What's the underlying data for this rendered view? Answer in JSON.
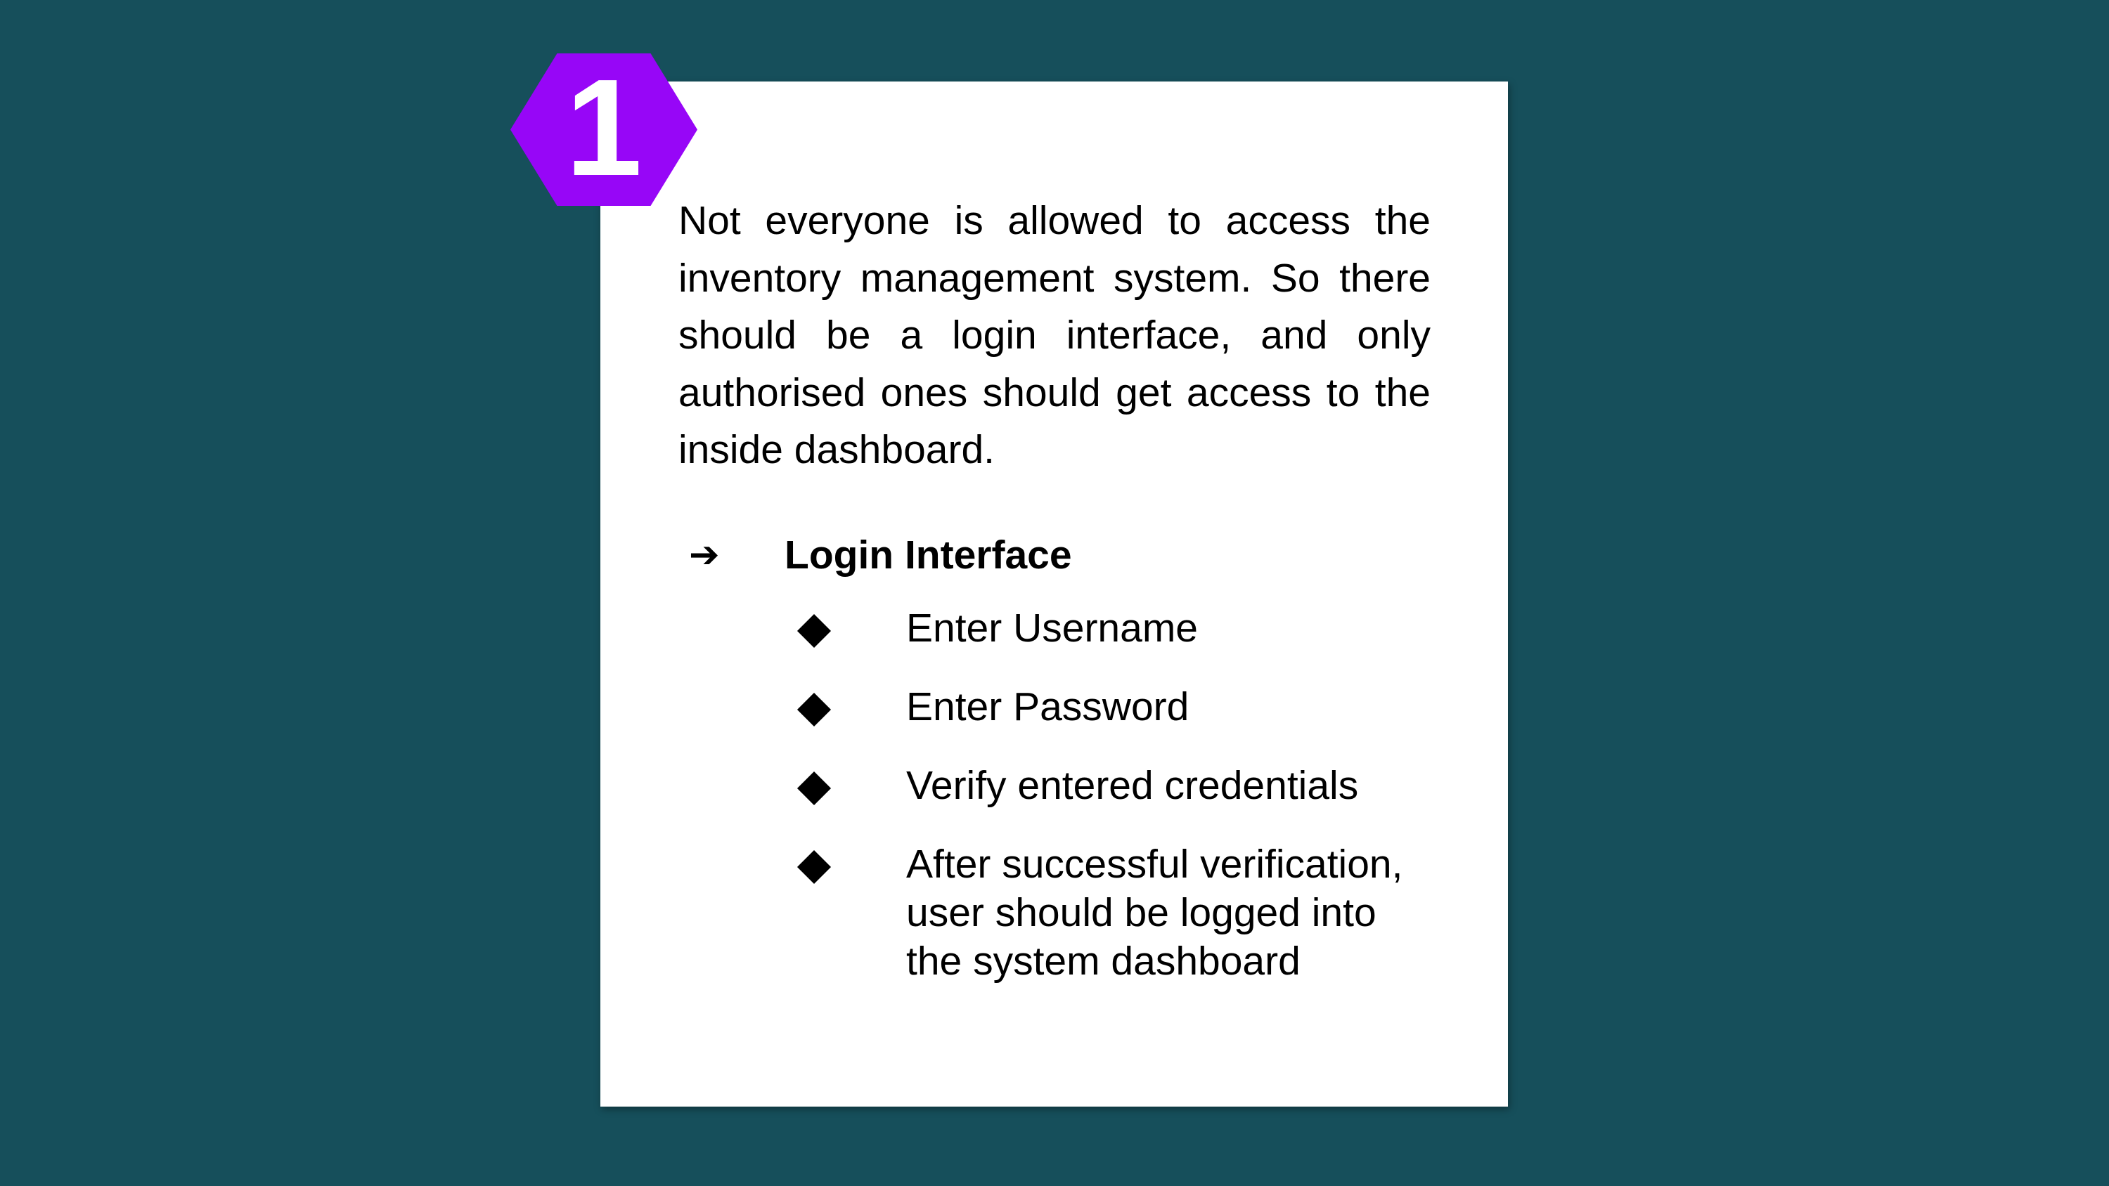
{
  "slide": {
    "number": "1",
    "intro_text": "Not everyone is allowed to access the inventory management system. So there should be a login interface, and only authorised ones should get access to the inside dashboard.",
    "section": {
      "arrow": "➔",
      "title": "Login Interface",
      "items": [
        "Enter Username",
        "Enter Password",
        "Verify entered credentials",
        "After successful verification, user should be logged into the system dashboard"
      ]
    }
  },
  "colors": {
    "background": "#164f5b",
    "card": "#ffffff",
    "badge": "#9706f7",
    "text": "#000000"
  },
  "icons": {
    "badge": "hexagon",
    "section_marker": "arrow-right-icon",
    "bullet": "diamond-icon"
  }
}
